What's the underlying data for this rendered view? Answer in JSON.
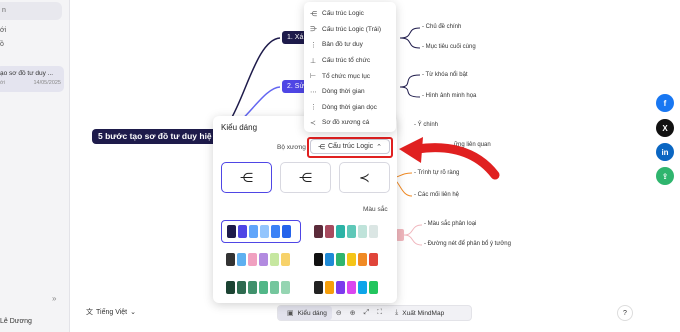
{
  "sidebar": {
    "search_text": "n",
    "section_1": "ới",
    "section_2": "ồ",
    "recent_item": {
      "title": "ạo sơ đồ tư duy ...",
      "meta_left": "ới",
      "meta_date": "14/05/2025"
    },
    "user_name": "Lê Dương"
  },
  "mindmap": {
    "root": "5 bước tạo sơ đồ tư duy hiệ",
    "branch_1": "1. Xá",
    "branch_2": "2. Sử",
    "leaves": {
      "chu_de": "- Chủ đề chính",
      "muc_tieu": "- Mục tiêu cuối cùng",
      "tu_khoa": "- Từ khóa nổi bật",
      "hinh_anh": "- Hình ảnh minh họa",
      "y_chinh": "- Ý chính",
      "lien_quan": "ững liên quan",
      "trinh_tu": "- Trình tự rõ ràng",
      "cac_moi": "- Các mối liên hệ",
      "mau_sac": "- Màu sắc phân loại",
      "duong_net": "- Đường nét để phân bổ ý tưởng"
    }
  },
  "layout_menu": {
    "items": [
      {
        "icon": "logic-right-icon",
        "glyph": "⋲",
        "label": "Cấu trúc Logic"
      },
      {
        "icon": "logic-left-icon",
        "glyph": "⋺",
        "label": "Cấu trúc Logic (Trái)"
      },
      {
        "icon": "mindmap-icon",
        "glyph": "⋮",
        "label": "Bản đồ tư duy"
      },
      {
        "icon": "org-chart-icon",
        "glyph": "⊥",
        "label": "Cấu trúc tổ chức"
      },
      {
        "icon": "directory-icon",
        "glyph": "⊢",
        "label": "Tổ chức mục lục"
      },
      {
        "icon": "timeline-icon",
        "glyph": "⋯",
        "label": "Dòng thời gian"
      },
      {
        "icon": "vertical-timeline-icon",
        "glyph": "⋮",
        "label": "Dòng thời gian dọc"
      },
      {
        "icon": "fishbone-icon",
        "glyph": "≺",
        "label": "Sơ đồ xương cá"
      }
    ]
  },
  "style_panel": {
    "title": "Kiểu dáng",
    "skeleton_label": "Bộ xương",
    "skeleton_value": "Cấu trúc Logic",
    "color_label": "Màu sắc",
    "layout_options": [
      "⋲",
      "⋲",
      "≺"
    ],
    "palettes": [
      [
        "#1e1b4b",
        "#4f46e5",
        "#60a5fa",
        "#93c5fd",
        "#3b82f6",
        "#2563eb"
      ],
      [
        "#5b2b3a",
        "#a84a5e",
        "#2bb3a6",
        "#5ec8b8",
        "#bfe3da",
        "#dbe6e4"
      ],
      [
        "#333333",
        "#5eb0f0",
        "#f0a0c0",
        "#b28ae0",
        "#c6e7a0",
        "#f7d26a"
      ],
      [
        "#111111",
        "#1f8ad6",
        "#2fb56e",
        "#f5c518",
        "#f08a24",
        "#e0453a"
      ],
      [
        "#1b4332",
        "#2d6a4f",
        "#40916c",
        "#52b788",
        "#74c69d",
        "#95d5b2"
      ],
      [
        "#222222",
        "#f59e0b",
        "#7c3aed",
        "#d946ef",
        "#0ea5e9",
        "#22c55e"
      ]
    ]
  },
  "toolbar": {
    "lang": "Tiếng Việt",
    "style_btn": "Kiểu dáng",
    "export_btn": "Xuất MindMap",
    "help": "?"
  },
  "social": {
    "facebook": "f",
    "x": "X",
    "linkedin": "in",
    "share": "⇪"
  }
}
